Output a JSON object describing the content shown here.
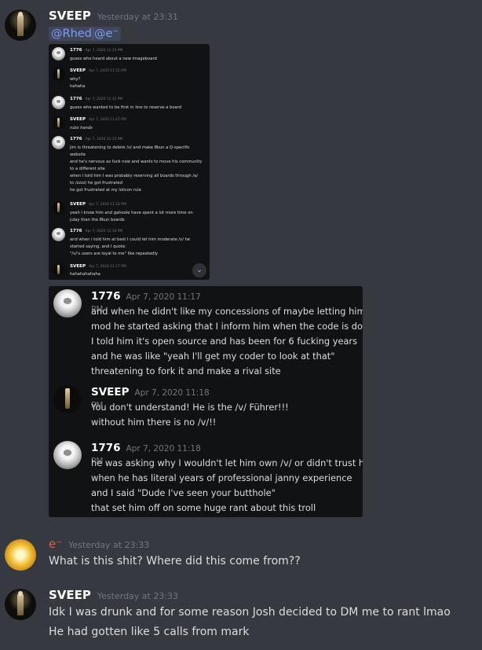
{
  "messages": [
    {
      "author": "SVEEP",
      "timestamp": "Yesterday at 23:31",
      "mentions": [
        "@Rhed",
        "@e⁻"
      ]
    },
    {
      "author": "e⁻",
      "timestamp": "Yesterday at 23:33",
      "text": "What is this shit? Where did this come from??"
    },
    {
      "author": "SVEEP",
      "timestamp": "Yesterday at 23:33",
      "lines": [
        "Idk I was drunk and for some reason Josh decided to DM me to rant lmao",
        "He had gotten like 5 calls from mark"
      ]
    }
  ],
  "screenshot1": [
    {
      "author": "1776",
      "time": "Apr 7, 2020 11:15 PM",
      "lines": [
        "guess who heard about a new imageboard"
      ]
    },
    {
      "author": "SVEEP",
      "time": "Apr 7, 2020 11:15 PM",
      "lines": [
        "why?",
        "hahaha"
      ]
    },
    {
      "author": "1776",
      "time": "Apr 7, 2020 11:15 PM",
      "lines": [
        "guess who wanted to be first in line to reserve a board"
      ]
    },
    {
      "author": "SVEEP",
      "time": "Apr 7, 2020 11:15 PM",
      "lines": [
        "rubs hands"
      ]
    },
    {
      "author": "1776",
      "time": "Apr 7, 2020 11:15 PM",
      "lines": [
        "Jim is threatening to delete /v/ and make 8kun a Q-specific",
        "website",
        "and he's nervous as fuck now and wants to move his community",
        "to a different site",
        "when I told him I was probably reserving all boards through /a/",
        "to /zzzz/ he got frustrated",
        "he got frustrated at my lolicon rule"
      ]
    },
    {
      "author": "SVEEP",
      "time": "Apr 7, 2020 11:16 PM",
      "lines": [
        "yeah I know him and gahoole have spent a lot more time on",
        "julay than the 8kun boards"
      ]
    },
    {
      "author": "1776",
      "time": "Apr 7, 2020 11:16 PM",
      "lines": [
        "and when i told him at best I could let him moderate /v/ he",
        "started saying, and I quote:",
        "\"/v/'s users are loyal to me\" like repeatedly"
      ]
    },
    {
      "author": "SVEEP",
      "time": "Apr 7, 2020 11:17 PM",
      "lines": [
        "hahahahahaha"
      ]
    }
  ],
  "screenshot2": [
    {
      "author": "1776",
      "time": "Apr 7, 2020 11:17 PM",
      "lines": [
        "and when he didn't like my concessions of maybe letting him",
        "mod he started asking that I inform him when the code is done",
        "I told him it's open source and has been for 6 fucking years",
        "and he was like \"yeah I'll get my coder to look at that\"",
        "threatening to fork it and make a rival site"
      ]
    },
    {
      "author": "SVEEP",
      "time": "Apr 7, 2020 11:18 PM",
      "lines": [
        "You don't understand! He is the /v/ Führer!!!",
        "without him there is no /v/!!"
      ]
    },
    {
      "author": "1776",
      "time": "Apr 7, 2020 11:18 PM",
      "lines": [
        "he was asking why I wouldn't let him own /v/ or didn't trust him",
        "when he has literal years of professional janny experience",
        "and I said \"Dude I've seen your butthole\"",
        "that set him off on some huge rant about this troll"
      ]
    }
  ],
  "colors": {
    "background": "#36393f",
    "username": "#ffffff",
    "username_e": "#e55b46",
    "mention": "#7f9ef6",
    "timestamp": "#72767d",
    "embed_bg": "#111213"
  },
  "icons": {
    "expand": "chevron-down-icon"
  }
}
